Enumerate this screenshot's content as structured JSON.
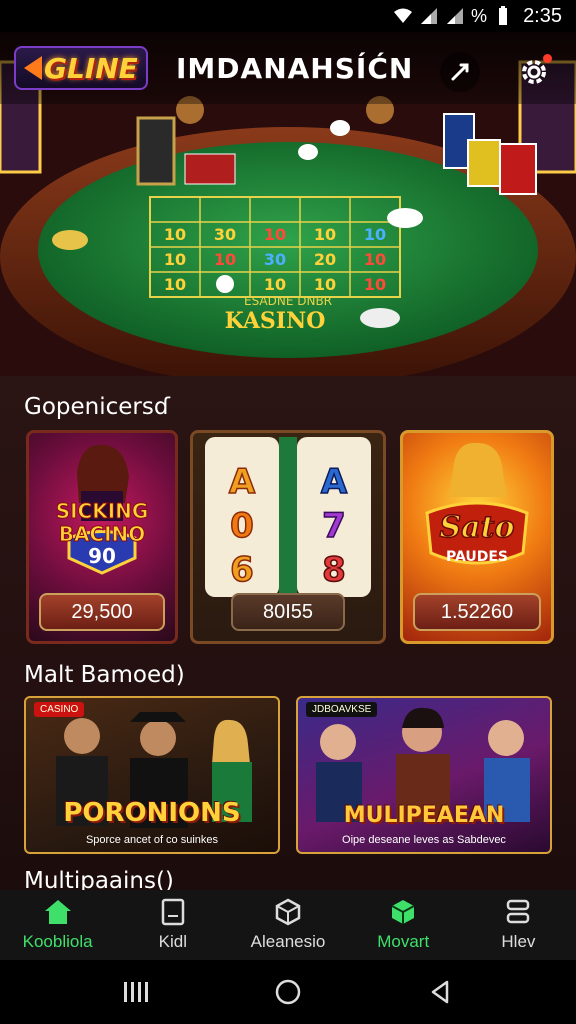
{
  "status_bar": {
    "time": "2:35",
    "battery_icon": "battery-icon",
    "wifi_icon": "wifi-icon",
    "signal_icon": "signal-icon"
  },
  "header": {
    "logo_text": "GLINE",
    "title": "IMDANAHSÍĆN",
    "share_icon": "share-icon",
    "settings_icon": "gear-icon",
    "accent_color": "#ffd23a"
  },
  "hero": {
    "table_label_top": "ESADNE DNBR",
    "table_label": "KASINO",
    "board_numbers": [
      "10",
      "30",
      "10",
      "10",
      "10",
      "10",
      "10",
      "30",
      "20",
      "10",
      "10",
      "10",
      "10",
      "10",
      "10"
    ]
  },
  "sections": {
    "top_title": "Gopenicersɗ",
    "middle_title": "Malt Bamoed)",
    "bottom_title": "Multipaains()"
  },
  "games": [
    {
      "title_line1": "SICKING",
      "title_line2": "BACINO",
      "badge": "90",
      "price": "29,500"
    },
    {
      "reel_symbols": [
        "A",
        "A",
        "0",
        "7",
        "6",
        "8"
      ],
      "price": "80I55"
    },
    {
      "title_line1": "Sato",
      "title_line2": "PAUDES",
      "price": "1.52260"
    }
  ],
  "promos": [
    {
      "tag": "CASINO",
      "title": "PORONIONS",
      "subtitle": "Sporce ancet of co suinkes"
    },
    {
      "tag": "JDBOAVKSE",
      "title": "MULIPEAEAN",
      "subtitle": "Oipe deseane leves as Sabdevec"
    }
  ],
  "bottom_nav": [
    {
      "label": "Koobliola",
      "icon": "home-icon",
      "active": true
    },
    {
      "label": "Kidl",
      "icon": "tablet-icon",
      "active": false
    },
    {
      "label": "Aleanesio",
      "icon": "cube-icon",
      "active": false
    },
    {
      "label": "Movart",
      "icon": "box-icon",
      "active": true
    },
    {
      "label": "Hlev",
      "icon": "stack-icon",
      "active": false
    }
  ],
  "colors": {
    "active": "#3fe06a",
    "background": "#241010",
    "gold": "#d8a23a"
  }
}
